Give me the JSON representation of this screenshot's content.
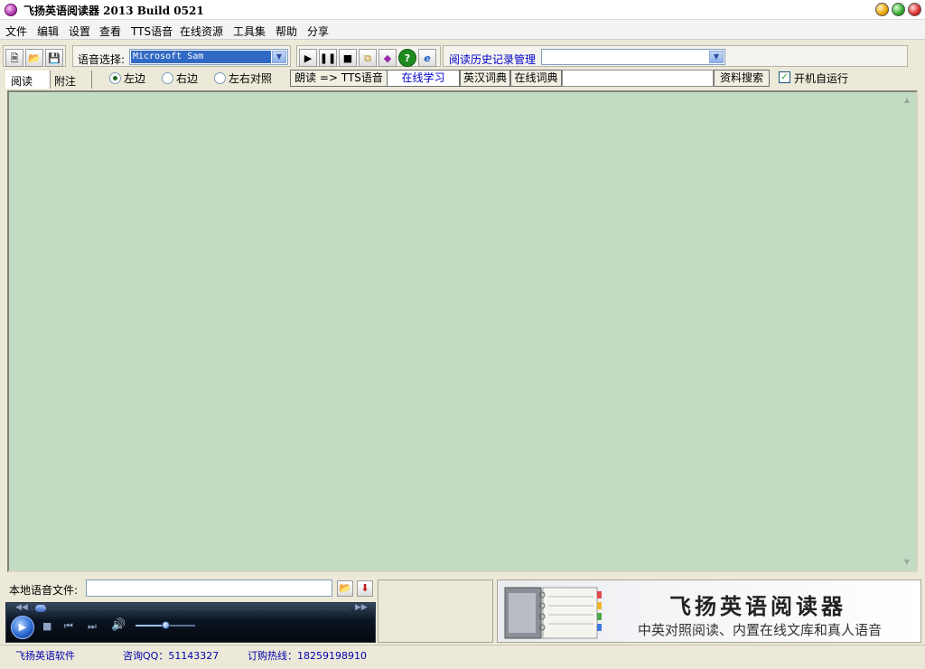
{
  "window": {
    "title": "飞扬英语阅读器 2013 Build 0521"
  },
  "menu": [
    "文件",
    "编辑",
    "设置",
    "查看",
    "TTS语音",
    "在线资源",
    "工具集",
    "帮助",
    "分享"
  ],
  "toolbar": {
    "voice_label": "语音选择:",
    "voice_value": "Microsoft Sam",
    "history_link": "阅读历史记录管理"
  },
  "tabs": [
    "阅读",
    "附注"
  ],
  "layout_options": {
    "items": [
      "左边",
      "右边",
      "左右对照"
    ],
    "selected": "左边"
  },
  "mode_buttons": [
    "朗读 => TTS语音",
    "在线学习",
    "英汉词典",
    "在线词典"
  ],
  "search_button": "资料搜索",
  "autostart": {
    "label": "开机自运行",
    "checked": true
  },
  "local_audio": {
    "label": "本地语音文件:",
    "value": ""
  },
  "player": {
    "seek_fraction": 0.02,
    "volume_fraction": 0.5
  },
  "banner": {
    "title": "飞扬英语阅读器",
    "subtitle": "中英对照阅读、内置在线文库和真人语音"
  },
  "status": {
    "software": "飞扬英语软件",
    "qq": "咨询QQ：51143327",
    "hotline": "订购热线：18259198910"
  },
  "colors": {
    "reading_area": "#c1dcc3",
    "window_bg": "#ece9d8",
    "link": "#0000cc"
  }
}
